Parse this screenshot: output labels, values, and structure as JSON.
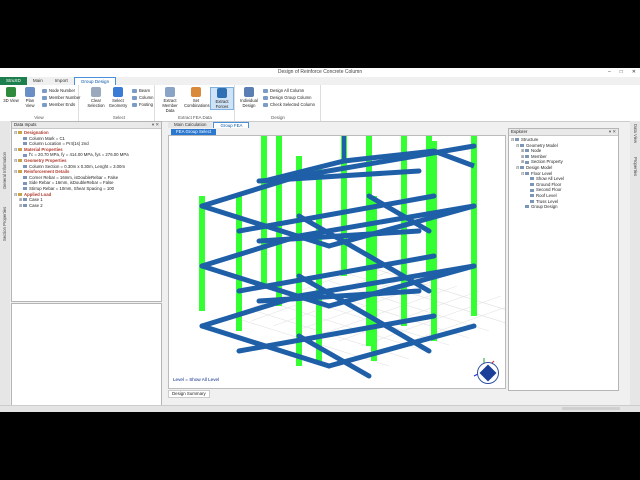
{
  "window": {
    "title": "Design of Reinforce Concrete Column",
    "controls": [
      "–",
      "□",
      "✕"
    ]
  },
  "ribbon_tabs": [
    "StruXD",
    "Main",
    "Import",
    "Group Design"
  ],
  "ribbon": {
    "view": {
      "label": "View",
      "buttons": [
        "3D View",
        "Plan View"
      ],
      "options": [
        "Node Number",
        "Member Number",
        "Member Ends"
      ]
    },
    "select": {
      "label": "Select",
      "buttons": [
        "Clear Selection",
        "Select Geometry"
      ],
      "options": [
        "Beam",
        "Column",
        "Footing"
      ]
    },
    "extract": {
      "label": "Extract FEA Data",
      "buttons": [
        "Extract Member Data",
        "Set Combinations",
        "Extract Forces"
      ]
    },
    "design": {
      "label": "Design",
      "buttons": [
        "Individual Design"
      ],
      "options": [
        "Design All Column",
        "Design Group Column",
        "Check Selected Column"
      ]
    }
  },
  "side_labels": {
    "left1": "General Information",
    "left2": "Section Properties",
    "right1": "Data View",
    "right2": "Properties"
  },
  "data_inputs": {
    "title": "Data Inputs",
    "rows": [
      {
        "text": "Designation",
        "level": 0,
        "kind": "hdr",
        "exp": "⊟"
      },
      {
        "text": "Column Mark = C1",
        "level": 1,
        "kind": "item",
        "exp": ""
      },
      {
        "text": "Column Location = Pr4(1s) 2nd",
        "level": 1,
        "kind": "item",
        "exp": ""
      },
      {
        "text": "Material Properties",
        "level": 0,
        "kind": "hdr",
        "exp": "⊟"
      },
      {
        "text": "f'c = 20.70 MPa, fy = 414.00 MPa, fys = 276.00 MPa",
        "level": 1,
        "kind": "item",
        "exp": ""
      },
      {
        "text": "Geometry Properties",
        "level": 0,
        "kind": "hdr",
        "exp": "⊟"
      },
      {
        "text": "Column Section = 0.30m x 0.30m, Lenght = 3.00m",
        "level": 1,
        "kind": "item",
        "exp": ""
      },
      {
        "text": "Reinforcement Details",
        "level": 0,
        "kind": "hdr",
        "exp": "⊟"
      },
      {
        "text": "Corner Rebar = 16mm, isDoubleRebar = False",
        "level": 1,
        "kind": "item",
        "exp": ""
      },
      {
        "text": "Side Rebar = 16mm, isDoubleRebar = False",
        "level": 1,
        "kind": "item",
        "exp": ""
      },
      {
        "text": "Stirrup Rebar = 10mm, Shear Spacing = 100",
        "level": 1,
        "kind": "item",
        "exp": ""
      },
      {
        "text": "Applied Load",
        "level": 0,
        "kind": "hdr",
        "exp": "⊟"
      },
      {
        "text": "Case 1",
        "level": 1,
        "kind": "item",
        "exp": "⊞"
      },
      {
        "text": "Case 2",
        "level": 1,
        "kind": "item",
        "exp": "⊞"
      }
    ]
  },
  "doc_tabs": [
    "Main Calculation",
    "Group FEA"
  ],
  "sub_tab": "FEA Group Select",
  "viewport": {
    "level_note": "Level = Show All Level",
    "bottom_tab": "Design Summary"
  },
  "explorer": {
    "title": "Explorer",
    "rows": [
      {
        "text": "Structure",
        "level": 0,
        "exp": "⊟"
      },
      {
        "text": "Geometry Model",
        "level": 1,
        "exp": "⊟"
      },
      {
        "text": "Node",
        "level": 2,
        "exp": "⊞"
      },
      {
        "text": "Member",
        "level": 2,
        "exp": "⊞"
      },
      {
        "text": "Section Property",
        "level": 2,
        "exp": "⊞"
      },
      {
        "text": "Design Model",
        "level": 1,
        "exp": "⊟"
      },
      {
        "text": "Floor Level",
        "level": 2,
        "exp": "⊟"
      },
      {
        "text": "Show All Level",
        "level": 3,
        "exp": ""
      },
      {
        "text": "Ground Floor",
        "level": 3,
        "exp": ""
      },
      {
        "text": "Second Floor",
        "level": 3,
        "exp": ""
      },
      {
        "text": "Roof Level",
        "level": 3,
        "exp": ""
      },
      {
        "text": "Truss Level",
        "level": 3,
        "exp": ""
      },
      {
        "text": "Group Design",
        "level": 2,
        "exp": ""
      }
    ]
  },
  "colors": {
    "beam": "#1f5fa8",
    "column": "#33ff33",
    "header": "#b03a2e",
    "accent": "#2b78d0"
  }
}
